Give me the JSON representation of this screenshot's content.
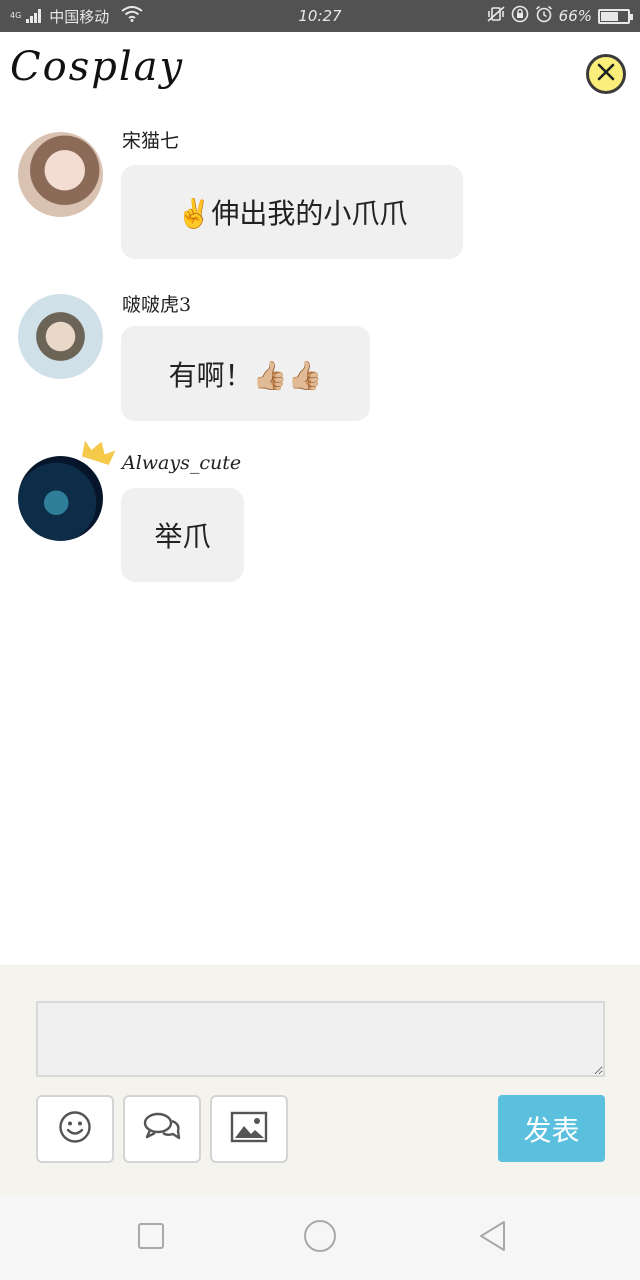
{
  "status_bar": {
    "network": "4G",
    "carrier": "中国移动",
    "time": "10:27",
    "battery": "66%",
    "battery_level": 0.66
  },
  "header": {
    "title": "Cosplay",
    "close_icon": "close-icon",
    "accent": "#fbee7a"
  },
  "messages": [
    {
      "user": "宋猫七",
      "text": "✌️伸出我的小爪爪"
    },
    {
      "user": "啵啵虎3",
      "text": "有啊！👍🏼👍🏼"
    },
    {
      "user": "Always_cute",
      "text": "举爪",
      "badge": "crown"
    }
  ],
  "composer": {
    "input_value": "",
    "tools": [
      "smiley-icon",
      "chat-icon",
      "image-icon"
    ],
    "send_label": "发表",
    "send_color": "#5bc0de"
  },
  "nav": [
    "recent-apps-icon",
    "home-icon",
    "back-icon"
  ]
}
